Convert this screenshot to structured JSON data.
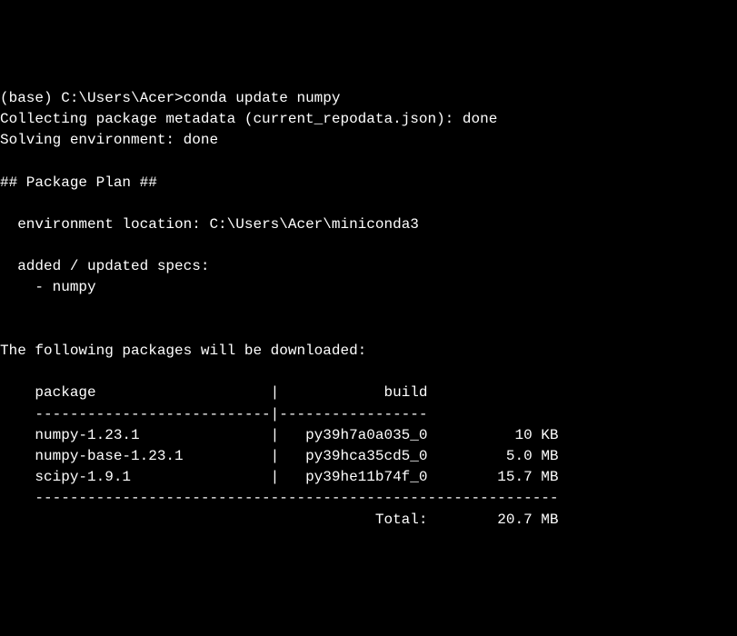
{
  "prompt": {
    "env": "(base)",
    "path": "C:\\Users\\Acer",
    "separator": ">",
    "command": "conda update numpy"
  },
  "output": {
    "collecting": "Collecting package metadata (current_repodata.json): done",
    "solving": "Solving environment: done",
    "plan_header": "## Package Plan ##",
    "env_location_label": "  environment location:",
    "env_location_value": "C:\\Users\\Acer\\miniconda3",
    "specs_label": "  added / updated specs:",
    "specs_item": "    - numpy",
    "download_header": "The following packages will be downloaded:",
    "table_header_package": "    package",
    "table_header_build": "build",
    "table_divider": "    ---------------------------|-----------------",
    "packages": [
      {
        "name": "    numpy-1.23.1",
        "build": "py39h7a0a035_0",
        "size": "10 KB"
      },
      {
        "name": "    numpy-base-1.23.1",
        "build": "py39hca35cd5_0",
        "size": "5.0 MB"
      },
      {
        "name": "    scipy-1.9.1",
        "build": "py39he11b74f_0",
        "size": "15.7 MB"
      }
    ],
    "bottom_divider": "    ------------------------------------------------------------",
    "total_label": "Total:",
    "total_value": "20.7 MB"
  }
}
